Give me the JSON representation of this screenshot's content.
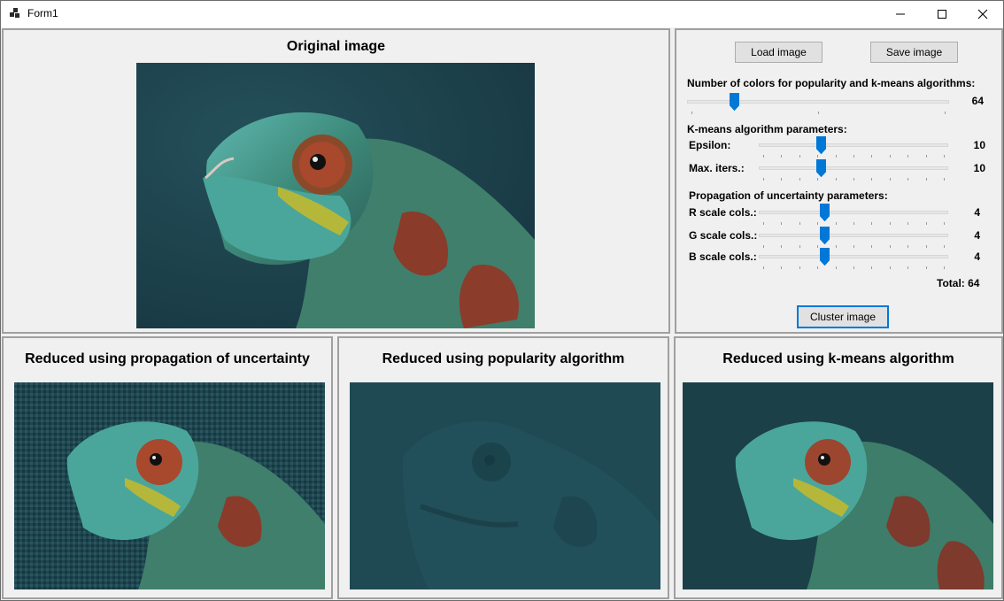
{
  "window": {
    "title": "Form1"
  },
  "titlebar": {
    "minimize": "minimize-icon",
    "maximize": "maximize-icon",
    "close": "close-icon"
  },
  "original": {
    "title": "Original image"
  },
  "controls": {
    "load_label": "Load image",
    "save_label": "Save image",
    "num_colors": {
      "label": "Number of colors for popularity and k-means algorithms:",
      "value": "64",
      "fraction": 0.17
    },
    "kmeans_header": "K-means algorithm parameters:",
    "epsilon": {
      "label": "Epsilon:",
      "value": "10",
      "fraction": 0.32
    },
    "max_iters": {
      "label": "Max. iters.:",
      "value": "10",
      "fraction": 0.32
    },
    "propagation_header": "Propagation of uncertainty parameters:",
    "r_scale": {
      "label": "R scale cols.:",
      "value": "4",
      "fraction": 0.34
    },
    "g_scale": {
      "label": "G scale cols.:",
      "value": "4",
      "fraction": 0.34
    },
    "b_scale": {
      "label": "B scale cols.:",
      "value": "4",
      "fraction": 0.34
    },
    "total": "Total: 64",
    "cluster_label": "Cluster image"
  },
  "results": {
    "propagation_title": "Reduced using propagation of uncertainty",
    "popularity_title": "Reduced using popularity algorithm",
    "kmeans_title": "Reduced using k-means algorithm"
  },
  "colors": {
    "background": "#f0f0f0",
    "accent": "#0078d7",
    "image_bg": "#1c3e48"
  }
}
